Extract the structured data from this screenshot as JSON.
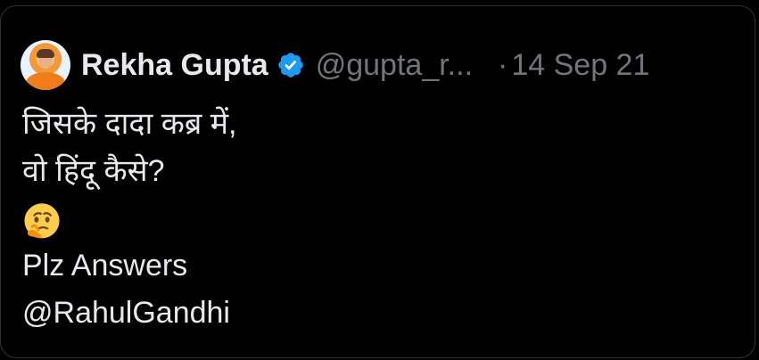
{
  "tweet": {
    "author_name": "Rekha Gupta",
    "author_handle": "@gupta_r...",
    "separator": "·",
    "date": "14 Sep 21",
    "verified": true,
    "lines": [
      "जिसके दादा कब्र में,",
      "वो हिंदू कैसे?",
      "Plz Answers",
      "@RahulGandhi"
    ],
    "emoji": "thinking-face-icon"
  },
  "colors": {
    "background": "#000000",
    "text": "#e7e9ea",
    "muted": "#71767b",
    "verified_badge": "#1d9bf0",
    "border": "#2f3336"
  }
}
